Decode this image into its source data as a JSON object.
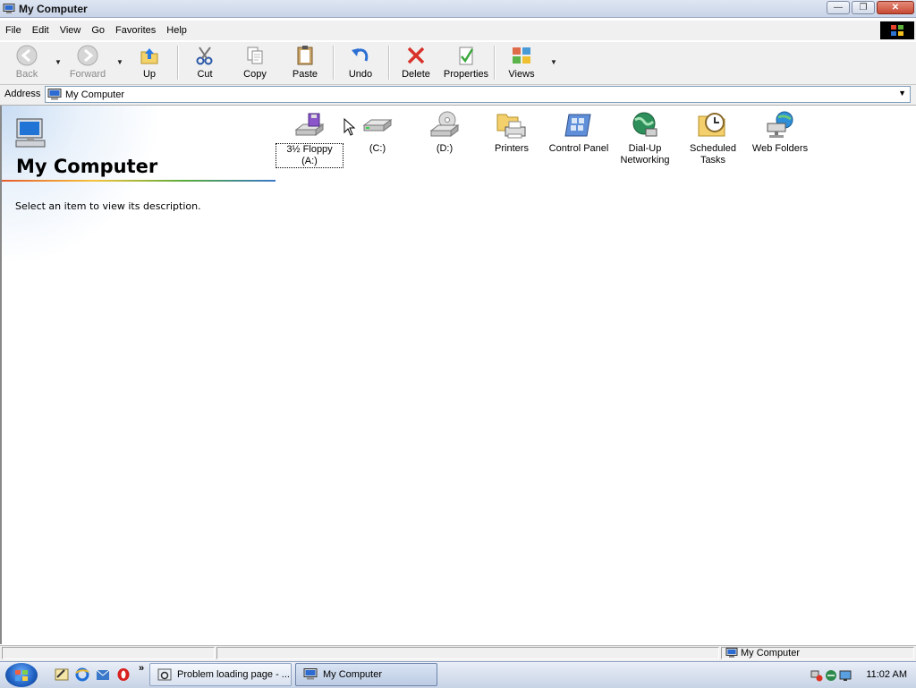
{
  "window": {
    "title": "My Computer"
  },
  "menu": [
    "File",
    "Edit",
    "View",
    "Go",
    "Favorites",
    "Help"
  ],
  "toolbar": {
    "back": "Back",
    "forward": "Forward",
    "up": "Up",
    "cut": "Cut",
    "copy": "Copy",
    "paste": "Paste",
    "undo": "Undo",
    "delete": "Delete",
    "properties": "Properties",
    "views": "Views"
  },
  "address": {
    "label": "Address",
    "value": "My Computer"
  },
  "panel": {
    "title": "My Computer",
    "description": "Select an item to view its description."
  },
  "items": [
    {
      "name": "3½ Floppy (A:)",
      "icon": "floppy-drive-icon",
      "selected": true
    },
    {
      "name": "(C:)",
      "icon": "hard-drive-icon"
    },
    {
      "name": "(D:)",
      "icon": "cd-drive-icon"
    },
    {
      "name": "Printers",
      "icon": "printers-folder-icon"
    },
    {
      "name": "Control Panel",
      "icon": "control-panel-icon"
    },
    {
      "name": "Dial-Up Networking",
      "icon": "dial-up-networking-icon"
    },
    {
      "name": "Scheduled Tasks",
      "icon": "scheduled-tasks-icon"
    },
    {
      "name": "Web Folders",
      "icon": "web-folders-icon"
    }
  ],
  "statusbar": {
    "text": "My Computer"
  },
  "taskbar": {
    "tasks": [
      {
        "label": "Problem loading page - ..."
      },
      {
        "label": "My Computer"
      }
    ],
    "clock": "11:02 AM"
  },
  "colors": {
    "accent": "#3978c9",
    "selection_border": "#000000"
  }
}
